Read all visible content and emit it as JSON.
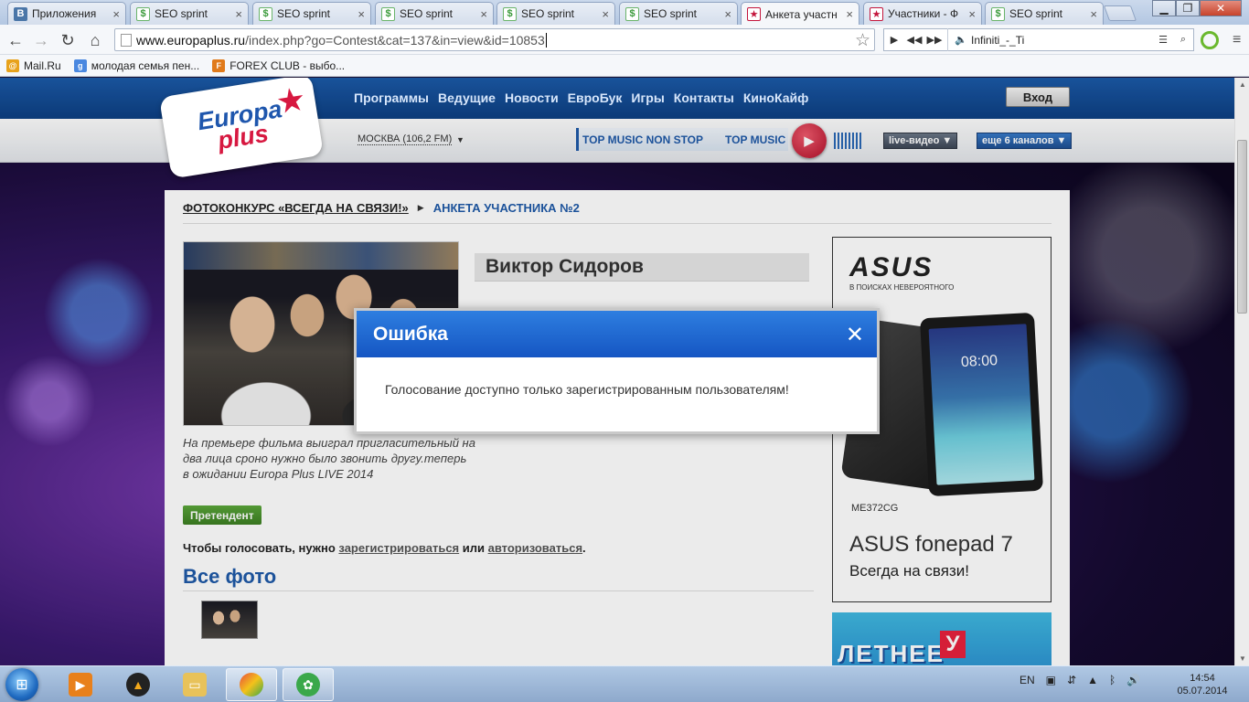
{
  "browser": {
    "tabs": [
      {
        "title": "Приложения",
        "icon": "vk-icon",
        "active": false
      },
      {
        "title": "SEO sprint",
        "icon": "seosprint-icon",
        "active": false
      },
      {
        "title": "SEO sprint",
        "icon": "seosprint-icon",
        "active": false
      },
      {
        "title": "SEO sprint",
        "icon": "seosprint-icon",
        "active": false
      },
      {
        "title": "SEO sprint",
        "icon": "seosprint-icon",
        "active": false
      },
      {
        "title": "SEO sprint",
        "icon": "seosprint-icon",
        "active": false
      },
      {
        "title": "Анкета участн",
        "icon": "europaplus-icon",
        "active": true
      },
      {
        "title": "Участники - Ф",
        "icon": "europaplus-icon",
        "active": false
      },
      {
        "title": "SEO sprint",
        "icon": "seosprint-icon",
        "active": false
      }
    ],
    "url_host": "www.europaplus.ru",
    "url_path": "/index.php?go=Contest&cat=137&in=view&id=10853",
    "player_track": "Infiniti_-_Ti",
    "bookmarks": [
      {
        "label": "Mail.Ru",
        "color": "#e8a21b"
      },
      {
        "label": "молодая семья пен...",
        "color": "#4a88e0"
      },
      {
        "label": "FOREX CLUB - выбо...",
        "color": "#e07a1b"
      }
    ]
  },
  "site": {
    "logo_line1": "Europa",
    "logo_line2": "plus",
    "nav": [
      "Программы",
      "Ведущие",
      "Новости",
      "ЕвроБук",
      "Игры",
      "Контакты",
      "КиноКайф"
    ],
    "login": "Вход",
    "city": "МОСКВА (106,2 FM)",
    "radio_strip": [
      "TOP MUSIC NON STOP",
      "TOP MUSIC"
    ],
    "live_video": "live-видео ▼",
    "more_channels": "еще 6 каналов ▼"
  },
  "contest": {
    "breadcrumb_link": "ФОТОКОНКУРС «ВСЕГДА НА СВЯЗИ!»",
    "breadcrumb_current": "АНКЕТА УЧАСТНИКА №2",
    "participant_name": "Виктор Сидоров",
    "description": "На премьере фильма выиграл пригласительный на два лица сроно нужно было звонить другу.теперь в ожидании Europa Plus LIVE 2014",
    "status_badge": "Претендент",
    "vote_prefix": "Чтобы голосовать, нужно ",
    "vote_register": "зарегистрироваться",
    "vote_or": " или ",
    "vote_login": "авторизоваться",
    "vote_suffix": ".",
    "all_photos": "Все фото"
  },
  "ad": {
    "brand": "ASUS",
    "tagline": "В ПОИСКАХ НЕВЕРОЯТНОГО",
    "tablet_clock": "08:00",
    "model": "ME372CG",
    "product": "ASUS fonepad 7",
    "slogan": "Всегда на связи!",
    "banner2": "ЛЕТНЕЕ",
    "banner2_letter": "У"
  },
  "modal": {
    "title": "Ошибка",
    "message": "Голосование доступно только зарегистрированным пользователям!"
  },
  "taskbar": {
    "lang": "EN",
    "time": "14:54",
    "date": "05.07.2014"
  },
  "colors": {
    "brand_blue": "#1f5aa8",
    "modal_header": "#1e66d4",
    "badge_green": "#4a9530"
  }
}
